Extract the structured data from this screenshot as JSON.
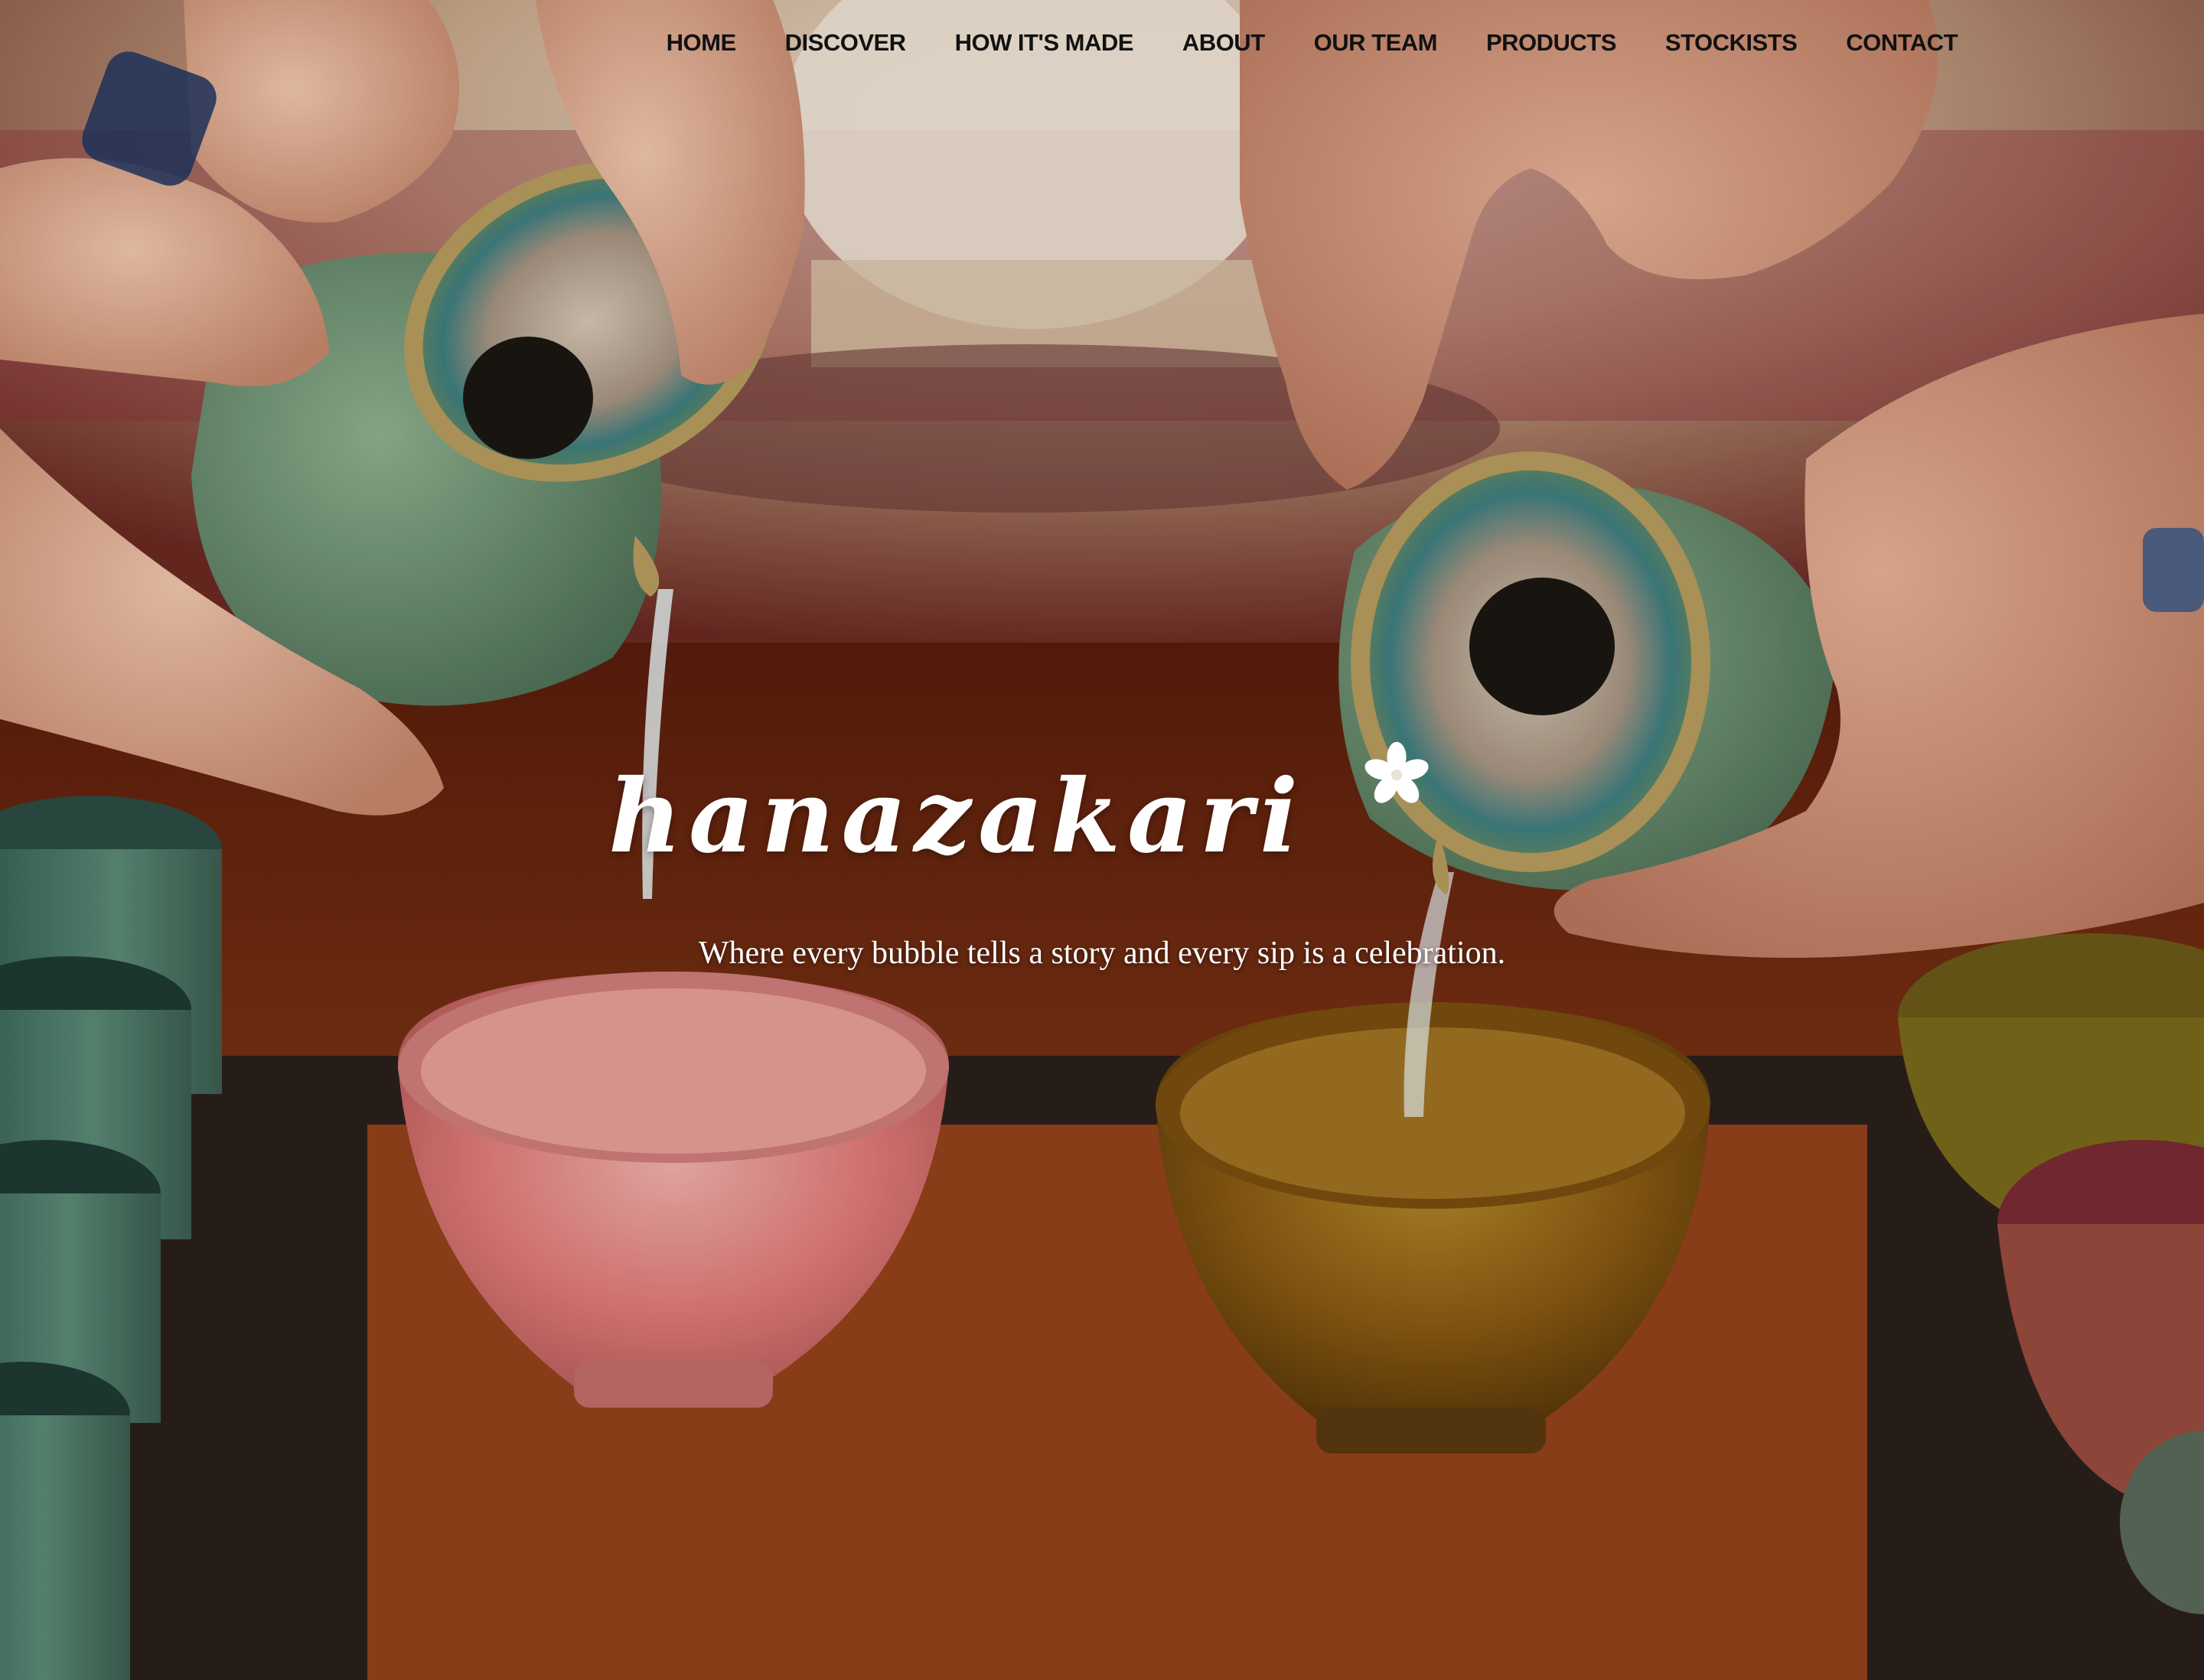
{
  "nav": {
    "items": [
      {
        "label": "HOME"
      },
      {
        "label": "DISCOVER"
      },
      {
        "label": "HOW IT'S MADE"
      },
      {
        "label": "ABOUT"
      },
      {
        "label": "OUR TEAM"
      },
      {
        "label": "PRODUCTS"
      },
      {
        "label": "STOCKISTS"
      },
      {
        "label": "CONTACT"
      }
    ]
  },
  "hero": {
    "brand": "hanazakari",
    "flower_icon": "blossom-icon",
    "tagline": "Where every bubble tells a story and every sip is a celebration."
  },
  "colors": {
    "nav_text": "#111111",
    "brand_text": "#ffffff",
    "tray": "#7a2f12",
    "pink_cup": "#e07a78",
    "amber_cup": "#8a5a12",
    "green_pitcher": "#5f8a66"
  }
}
